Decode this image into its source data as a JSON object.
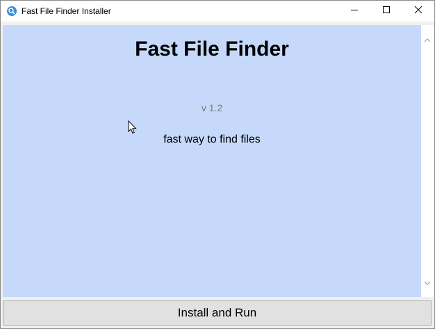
{
  "window": {
    "title": "Fast File Finder Installer"
  },
  "titlebar": {
    "icons": {
      "app": "search-icon",
      "minimize": "minimize-icon",
      "maximize": "maximize-icon",
      "close": "close-icon"
    }
  },
  "main": {
    "app_name": "Fast File Finder",
    "version": "v 1.2",
    "tagline": "fast way to find files"
  },
  "footer": {
    "install_label": "Install and Run"
  },
  "colors": {
    "content_background": "#c6d9fa",
    "version_text": "#7a7a7a",
    "button_background": "#e1e1e1",
    "app_icon": "#3a8fd6"
  }
}
